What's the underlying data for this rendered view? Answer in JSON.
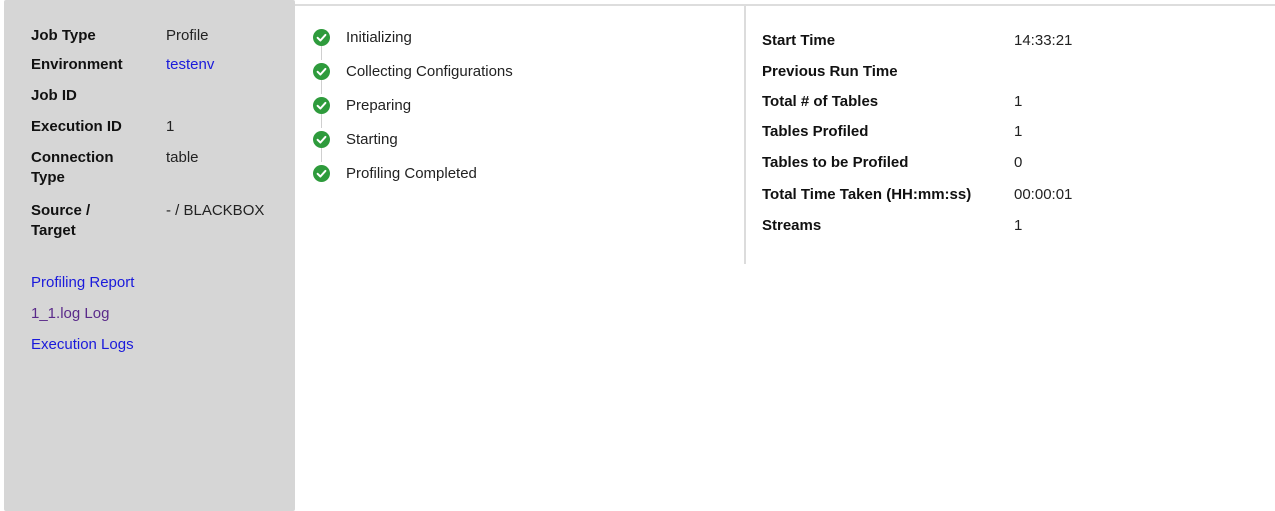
{
  "info": {
    "job_type_label": "Job Type",
    "job_type_value": "Profile",
    "environment_label": "Environment",
    "environment_value": "testenv",
    "job_id_label": "Job ID",
    "job_id_value": "",
    "execution_id_label": "Execution ID",
    "execution_id_value": "1",
    "connection_type_label": "Connection Type",
    "connection_type_value": "table",
    "source_target_label": "Source / Target",
    "source_target_value": "- / BLACKBOX"
  },
  "links": {
    "profiling_report": "Profiling Report",
    "log_file": "1_1.log Log",
    "execution_logs": "Execution Logs"
  },
  "steps": [
    {
      "label": "Initializing",
      "status": "complete"
    },
    {
      "label": "Collecting Configurations",
      "status": "complete"
    },
    {
      "label": "Preparing",
      "status": "complete"
    },
    {
      "label": "Starting",
      "status": "complete"
    },
    {
      "label": "Profiling Completed",
      "status": "complete"
    }
  ],
  "stats": [
    {
      "label": "Start Time",
      "value": "14:33:21"
    },
    {
      "label": "Previous Run Time",
      "value": ""
    },
    {
      "label": "Total # of Tables",
      "value": "1"
    },
    {
      "label": "Tables Profiled",
      "value": "1"
    },
    {
      "label": "Tables to be Profiled",
      "value": "0"
    },
    {
      "label": "Total Time Taken (HH:mm:ss)",
      "value": "00:00:01"
    },
    {
      "label": "Streams",
      "value": "1"
    }
  ],
  "colors": {
    "panel_bg": "#d6d6d6",
    "link": "#1a1adb",
    "visited_link": "#5a2a8a",
    "check_green": "#2e9b3c"
  },
  "icons": {
    "step_status": "check-circle-icon"
  }
}
